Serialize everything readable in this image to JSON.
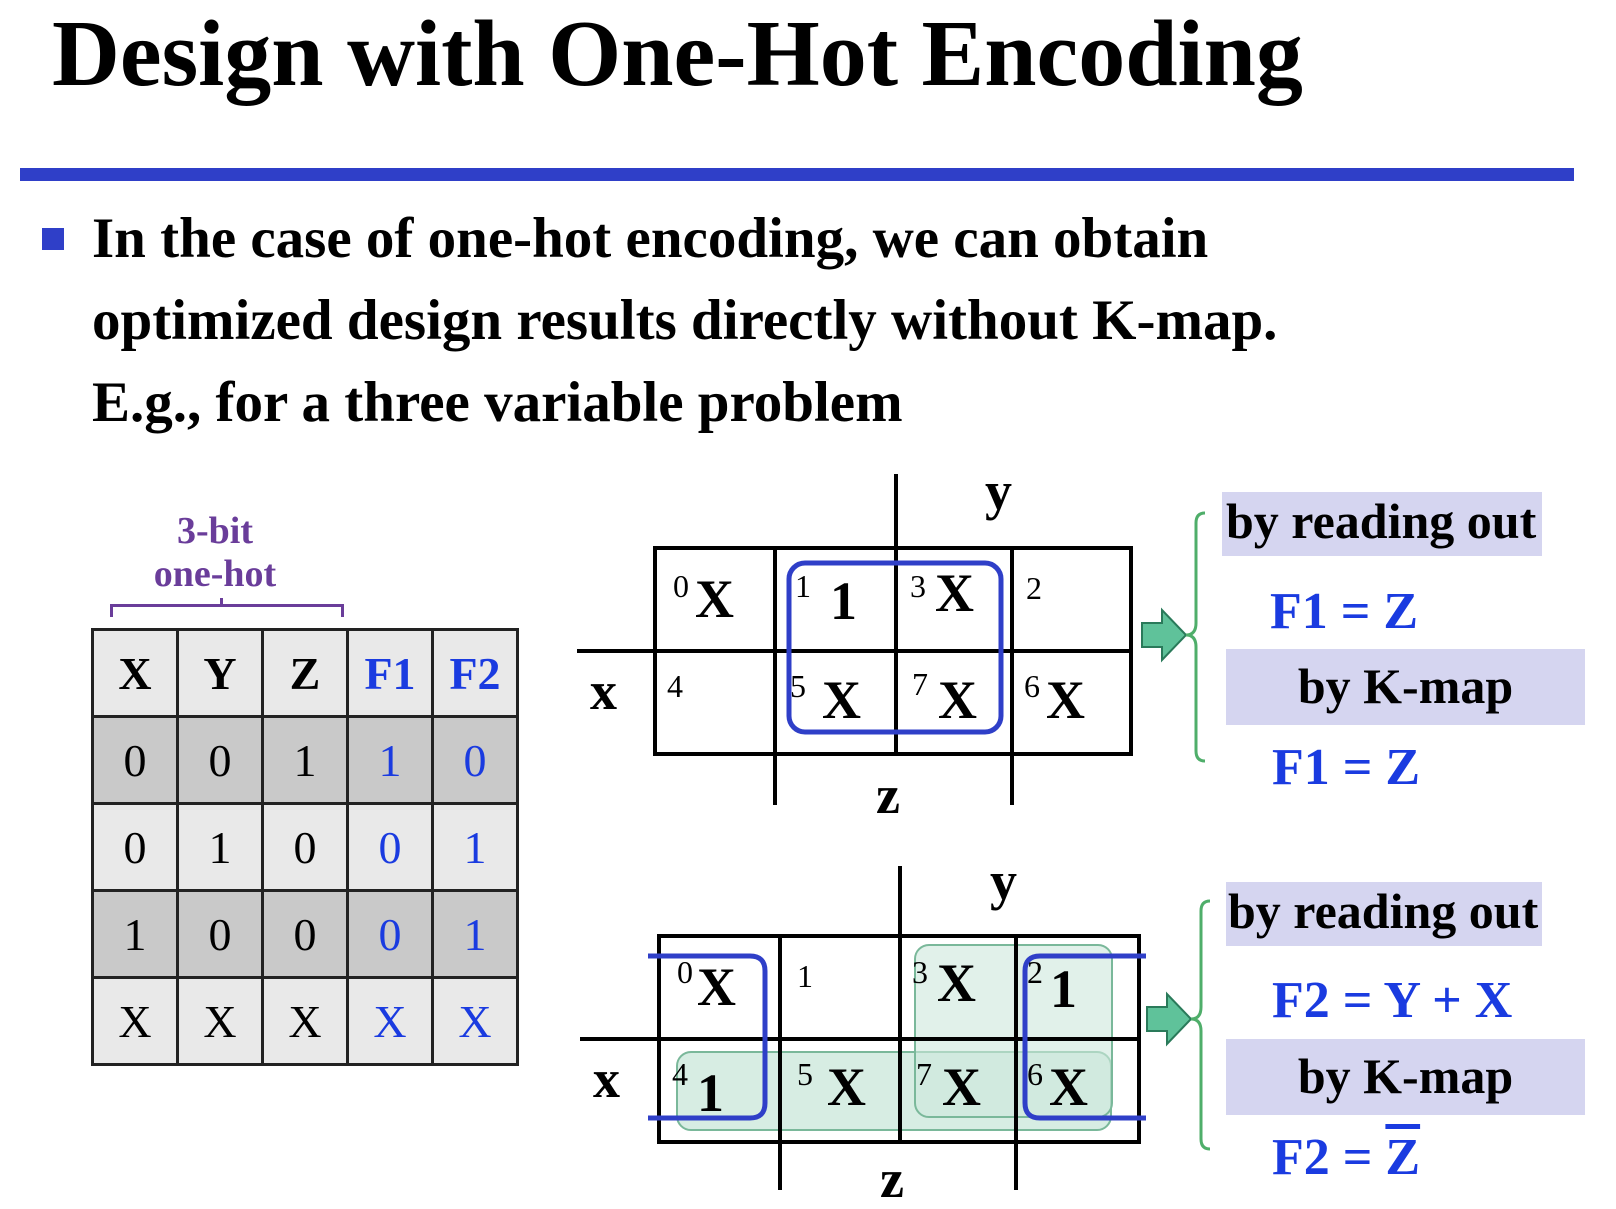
{
  "slide": {
    "title": "Design with One-Hot Encoding",
    "accent_color": "#2f3fc8",
    "bullet": {
      "icon": "square-bullet-icon",
      "lines": [
        "In the case of one-hot encoding, we can obtain",
        "optimized design results directly without K-map.",
        "E.g., for a three variable problem"
      ]
    }
  },
  "annotation": {
    "line1": "3-bit",
    "line2": "one-hot"
  },
  "truth_table": {
    "headers": [
      "X",
      "Y",
      "Z",
      "F1",
      "F2"
    ],
    "rows": [
      [
        "0",
        "0",
        "1",
        "1",
        "0"
      ],
      [
        "0",
        "1",
        "0",
        "0",
        "1"
      ],
      [
        "1",
        "0",
        "0",
        "0",
        "1"
      ],
      [
        "X",
        "X",
        "X",
        "X",
        "X"
      ]
    ]
  },
  "kmap1": {
    "labels": {
      "y": "y",
      "x": "x",
      "z": "z"
    },
    "cells": [
      {
        "num": "0",
        "val": "X"
      },
      {
        "num": "1",
        "val": "1"
      },
      {
        "num": "3",
        "val": "X"
      },
      {
        "num": "2",
        "val": ""
      },
      {
        "num": "4",
        "val": ""
      },
      {
        "num": "5",
        "val": "X"
      },
      {
        "num": "7",
        "val": "X"
      },
      {
        "num": "6",
        "val": "X"
      }
    ]
  },
  "kmap2": {
    "labels": {
      "y": "y",
      "x": "x",
      "z": "z"
    },
    "cells": [
      {
        "num": "0",
        "val": "X"
      },
      {
        "num": "1",
        "val": ""
      },
      {
        "num": "3",
        "val": "X"
      },
      {
        "num": "2",
        "val": "1"
      },
      {
        "num": "4",
        "val": "1"
      },
      {
        "num": "5",
        "val": "X"
      },
      {
        "num": "7",
        "val": "X"
      },
      {
        "num": "6",
        "val": "X"
      }
    ]
  },
  "result1": {
    "reading_label": "by reading out",
    "reading_eq": "F1 = Z",
    "kmap_label": "by K-map",
    "kmap_eq": "F1 = Z"
  },
  "result2": {
    "reading_label": "by reading out",
    "reading_eq": "F2 = Y + X",
    "kmap_label": "by K-map",
    "kmap_eq_prefix": "F2 = ",
    "kmap_eq_var": "Z"
  }
}
